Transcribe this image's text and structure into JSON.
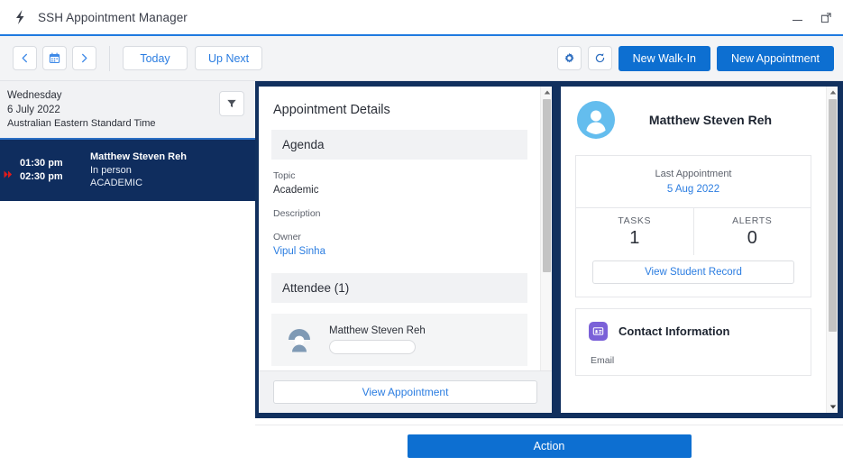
{
  "window": {
    "title": "SSH Appointment Manager",
    "logo_icon": "lightning-bolt-icon",
    "minimize_label": "Minimize",
    "restore_label": "Restore Down"
  },
  "toolbar": {
    "prev_icon": "chevron-left-icon",
    "calendar_icon": "calendar-icon",
    "next_icon": "chevron-right-icon",
    "today_label": "Today",
    "up_next_label": "Up Next",
    "settings_icon": "gear-icon",
    "refresh_icon": "refresh-icon",
    "new_walk_in_label": "New Walk-In",
    "new_appointment_label": "New Appointment"
  },
  "sidebar": {
    "weekday": "Wednesday",
    "date": "6 July 2022",
    "timezone": "Australian Eastern Standard Time",
    "filter_icon": "filter-funnel-icon",
    "appointments": [
      {
        "marker_icon": "double-chevron-right-icon",
        "start_time": "01:30 pm",
        "end_time": "02:30 pm",
        "name": "Matthew Steven Reh",
        "mode": "In person",
        "category": "ACADEMIC"
      }
    ]
  },
  "details": {
    "title": "Appointment Details",
    "agenda_header": "Agenda",
    "topic_label": "Topic",
    "topic_value": "Academic",
    "description_label": "Description",
    "description_value": "",
    "owner_label": "Owner",
    "owner_value": "Vipul Sinha",
    "attendee_header": "Attendee (1)",
    "attendee_name": "Matthew Steven Reh",
    "attendee_avatar_icon": "user-avatar-icon",
    "view_appointment_label": "View Appointment",
    "scroll_up_icon": "scroll-up-arrow-icon",
    "scroll_down_icon": "scroll-down-arrow-icon"
  },
  "student": {
    "avatar_icon": "user-avatar-icon",
    "name": "Matthew Steven Reh",
    "last_appointment_label": "Last Appointment",
    "last_appointment_date": "5 Aug 2022",
    "tasks_label": "TASKS",
    "tasks_count": "1",
    "alerts_label": "ALERTS",
    "alerts_count": "0",
    "view_student_record_label": "View Student Record",
    "contact_icon": "contact-card-icon",
    "contact_title": "Contact Information",
    "email_label": "Email",
    "scroll_up_icon": "scroll-up-arrow-icon",
    "scroll_down_icon": "scroll-down-arrow-icon"
  },
  "footer": {
    "action_label": "Action"
  },
  "colors": {
    "accent_blue": "#0d6fd1",
    "link_blue": "#2b7de1",
    "panel_navy": "#11305e",
    "appointment_navy": "#0f2d5e",
    "contact_purple": "#7b61d8",
    "marker_red": "#e01b1b"
  }
}
